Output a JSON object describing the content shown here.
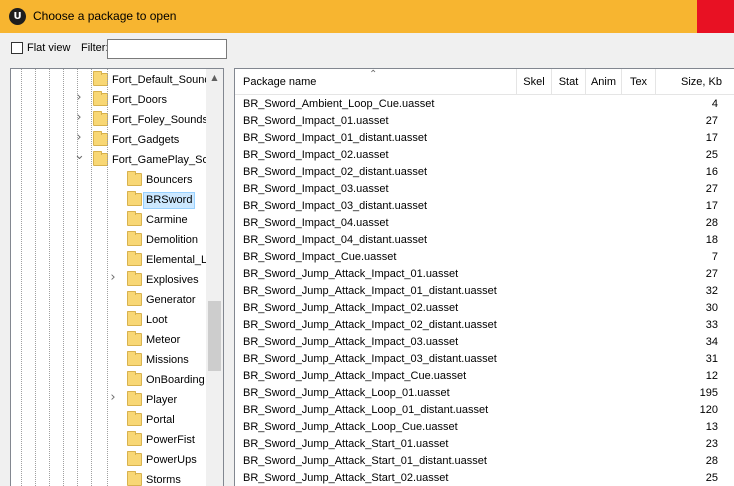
{
  "window": {
    "title": "Choose a package to open",
    "icon": "unreal-engine-icon"
  },
  "toolbar": {
    "flat_view_label": "Flat view",
    "flat_view_checked": false,
    "filter_label": "Filter:",
    "filter_value": ""
  },
  "tree": {
    "items": [
      {
        "label": "Fort_Default_Sound",
        "expander": "none"
      },
      {
        "label": "Fort_Doors",
        "expander": "collapsed"
      },
      {
        "label": "Fort_Foley_Sounds",
        "expander": "collapsed"
      },
      {
        "label": "Fort_Gadgets",
        "expander": "collapsed"
      },
      {
        "label": "Fort_GamePlay_Sou",
        "expander": "expanded"
      },
      {
        "label": "Bouncers",
        "expander": "none"
      },
      {
        "label": "BRSword",
        "expander": "none",
        "selected": true
      },
      {
        "label": "Carmine",
        "expander": "none"
      },
      {
        "label": "Demolition",
        "expander": "none"
      },
      {
        "label": "Elemental_Layer",
        "expander": "none"
      },
      {
        "label": "Explosives",
        "expander": "collapsed"
      },
      {
        "label": "Generator",
        "expander": "none"
      },
      {
        "label": "Loot",
        "expander": "none"
      },
      {
        "label": "Meteor",
        "expander": "none"
      },
      {
        "label": "Missions",
        "expander": "none"
      },
      {
        "label": "OnBoarding",
        "expander": "none"
      },
      {
        "label": "Player",
        "expander": "collapsed"
      },
      {
        "label": "Portal",
        "expander": "none"
      },
      {
        "label": "PowerFist",
        "expander": "none"
      },
      {
        "label": "PowerUps",
        "expander": "none"
      },
      {
        "label": "Storms",
        "expander": "none"
      }
    ]
  },
  "list": {
    "columns": [
      "Package name",
      "Skel",
      "Stat",
      "Anim",
      "Tex",
      "Size, Kb"
    ],
    "sort_column": "Package name",
    "rows": [
      {
        "name": "BR_Sword_Ambient_Loop_Cue.uasset",
        "size": "4"
      },
      {
        "name": "BR_Sword_Impact_01.uasset",
        "size": "27"
      },
      {
        "name": "BR_Sword_Impact_01_distant.uasset",
        "size": "17"
      },
      {
        "name": "BR_Sword_Impact_02.uasset",
        "size": "25"
      },
      {
        "name": "BR_Sword_Impact_02_distant.uasset",
        "size": "16"
      },
      {
        "name": "BR_Sword_Impact_03.uasset",
        "size": "27"
      },
      {
        "name": "BR_Sword_Impact_03_distant.uasset",
        "size": "17"
      },
      {
        "name": "BR_Sword_Impact_04.uasset",
        "size": "28"
      },
      {
        "name": "BR_Sword_Impact_04_distant.uasset",
        "size": "18"
      },
      {
        "name": "BR_Sword_Impact_Cue.uasset",
        "size": "7"
      },
      {
        "name": "BR_Sword_Jump_Attack_Impact_01.uasset",
        "size": "27"
      },
      {
        "name": "BR_Sword_Jump_Attack_Impact_01_distant.uasset",
        "size": "32"
      },
      {
        "name": "BR_Sword_Jump_Attack_Impact_02.uasset",
        "size": "30"
      },
      {
        "name": "BR_Sword_Jump_Attack_Impact_02_distant.uasset",
        "size": "33"
      },
      {
        "name": "BR_Sword_Jump_Attack_Impact_03.uasset",
        "size": "34"
      },
      {
        "name": "BR_Sword_Jump_Attack_Impact_03_distant.uasset",
        "size": "31"
      },
      {
        "name": "BR_Sword_Jump_Attack_Impact_Cue.uasset",
        "size": "12"
      },
      {
        "name": "BR_Sword_Jump_Attack_Loop_01.uasset",
        "size": "195"
      },
      {
        "name": "BR_Sword_Jump_Attack_Loop_01_distant.uasset",
        "size": "120"
      },
      {
        "name": "BR_Sword_Jump_Attack_Loop_Cue.uasset",
        "size": "13"
      },
      {
        "name": "BR_Sword_Jump_Attack_Start_01.uasset",
        "size": "23"
      },
      {
        "name": "BR_Sword_Jump_Attack_Start_01_distant.uasset",
        "size": "28"
      },
      {
        "name": "BR_Sword_Jump_Attack_Start_02.uasset",
        "size": "25"
      }
    ]
  },
  "colors": {
    "titlebar": "#f7b530",
    "close_button": "#e81123",
    "selection": "#cce8ff"
  }
}
